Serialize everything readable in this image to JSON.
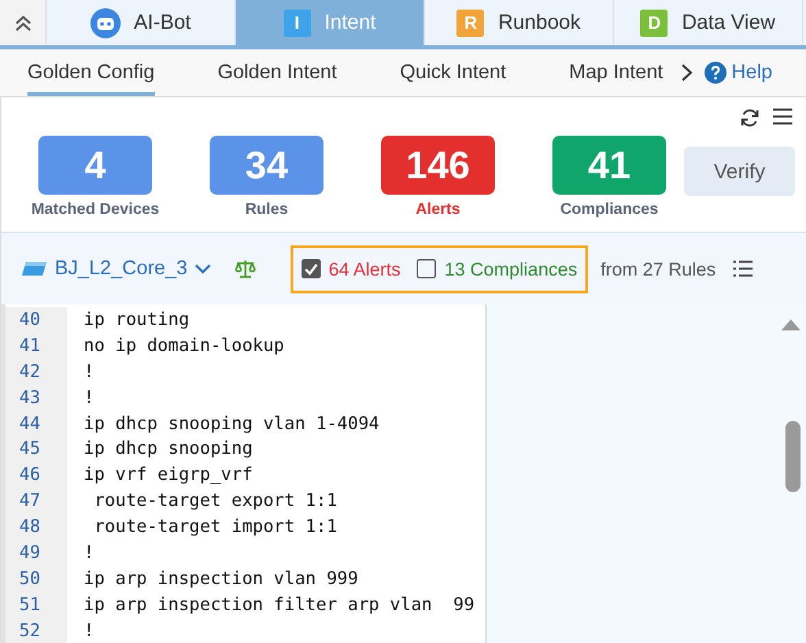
{
  "app_tabs": [
    {
      "label": "AI-Bot",
      "kind": "robot",
      "selected": false
    },
    {
      "label": "Intent",
      "kind": "letter",
      "letter": "I",
      "selected": true
    },
    {
      "label": "Runbook",
      "kind": "letter",
      "letter": "R",
      "selected": false
    },
    {
      "label": "Data View",
      "kind": "letter",
      "letter": "D",
      "selected": false
    }
  ],
  "sub_tabs": [
    {
      "label": "Golden Config",
      "selected": true
    },
    {
      "label": "Golden Intent",
      "selected": false
    },
    {
      "label": "Quick Intent",
      "selected": false
    },
    {
      "label": "Map Intent",
      "selected": false
    }
  ],
  "help": "Help",
  "stats": [
    {
      "value": "4",
      "label": "Matched Devices",
      "color": "#5b93e8"
    },
    {
      "value": "34",
      "label": "Rules",
      "color": "#5b93e8"
    },
    {
      "value": "146",
      "label": "Alerts",
      "color": "#e3302f"
    },
    {
      "value": "41",
      "label": "Compliances",
      "color": "#10a56b"
    }
  ],
  "verify_button": "Verify",
  "device": "BJ_L2_Core_3",
  "filters": [
    {
      "label": "64 Alerts",
      "checked": true,
      "color": "#e0313c"
    },
    {
      "label": "13 Compliances",
      "checked": false,
      "color": "#2f8a2f"
    }
  ],
  "from_rules": "from 27 Rules",
  "code_lines": [
    {
      "number": "40",
      "text": "ip routing"
    },
    {
      "number": "41",
      "text": "no ip domain-lookup"
    },
    {
      "number": "42",
      "text": "!"
    },
    {
      "number": "43",
      "text": "!"
    },
    {
      "number": "44",
      "text": "ip dhcp snooping vlan 1-4094"
    },
    {
      "number": "45",
      "text": "ip dhcp snooping"
    },
    {
      "number": "46",
      "text": "ip vrf eigrp_vrf"
    },
    {
      "number": "47",
      "text": " route-target export 1:1"
    },
    {
      "number": "48",
      "text": " route-target import 1:1"
    },
    {
      "number": "49",
      "text": "!"
    },
    {
      "number": "50",
      "text": "ip arp inspection vlan 999"
    },
    {
      "number": "51",
      "text": "ip arp inspection filter arp vlan  99"
    },
    {
      "number": "52",
      "text": "!"
    }
  ]
}
